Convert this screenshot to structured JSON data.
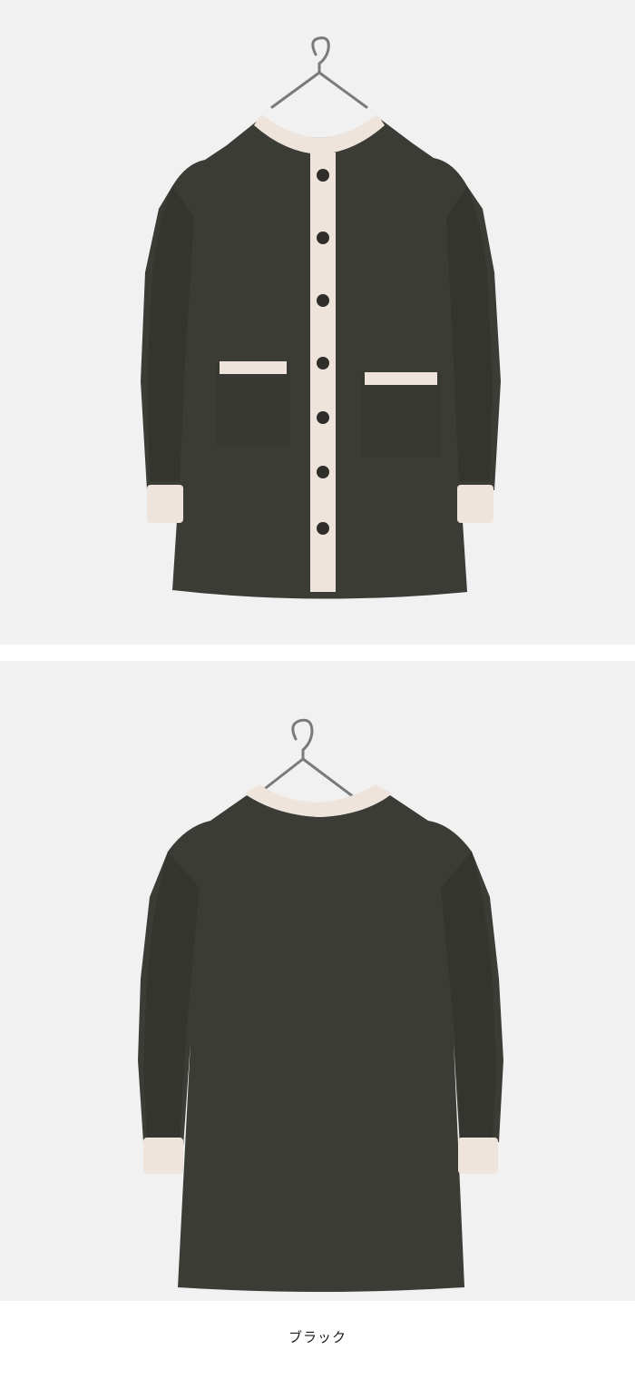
{
  "colors": {
    "background": "#f1f1f1",
    "garment": "#3c3c37",
    "trim": "#efe4dc",
    "button": "#2f2e2b"
  },
  "caption": {
    "color_name": "ブラック"
  }
}
